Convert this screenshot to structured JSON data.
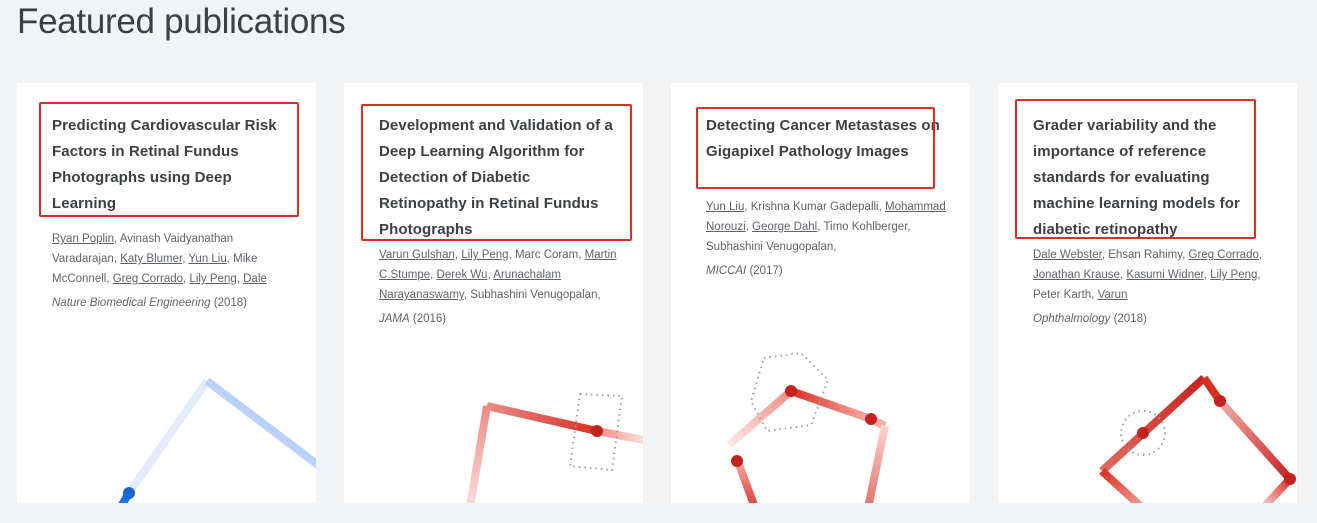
{
  "page": {
    "title": "Featured publications"
  },
  "cards": [
    {
      "title": "Predicting Cardiovascular Risk Factors in Retinal Fundus Photographs using Deep Learning",
      "authors": [
        {
          "name": "Ryan Poplin",
          "link": true
        },
        {
          "name": "Avinash Vaidyanathan Varadarajan",
          "link": false
        },
        {
          "name": "Katy Blumer",
          "link": true
        },
        {
          "name": "Yun Liu",
          "link": true
        },
        {
          "name": "Mike McConnell",
          "link": false
        },
        {
          "name": "Greg Corrado",
          "link": true
        },
        {
          "name": "Lily Peng",
          "link": true
        },
        {
          "name": "Dale",
          "link": true
        }
      ],
      "venue": "Nature Biomedical Engineering",
      "year": "(2018)"
    },
    {
      "title": "Development and Validation of a Deep Learning Algorithm for Detection of Diabetic Retinopathy in Retinal Fundus Photographs",
      "authors": [
        {
          "name": "Varun Gulshan",
          "link": true
        },
        {
          "name": "Lily Peng",
          "link": true
        },
        {
          "name": "Marc Coram",
          "link": false
        },
        {
          "name": "Martin C Stumpe",
          "link": true
        },
        {
          "name": "Derek Wu",
          "link": true
        },
        {
          "name": "Arunachalam Narayanaswamy",
          "link": true
        },
        {
          "name": "Subhashini Venugopalan",
          "link": false
        }
      ],
      "venue": "JAMA",
      "year": "(2016)"
    },
    {
      "title": "Detecting Cancer Metastases on Gigapixel Pathology Images",
      "authors": [
        {
          "name": "Yun Liu",
          "link": true
        },
        {
          "name": "Krishna Kumar Gadepalli",
          "link": false
        },
        {
          "name": "Mohammad Norouzi",
          "link": true
        },
        {
          "name": "George Dahl",
          "link": true
        },
        {
          "name": "Timo Kohlberger",
          "link": false
        },
        {
          "name": "Subhashini Venugopalan",
          "link": false
        }
      ],
      "venue": "MICCAI",
      "year": "(2017)"
    },
    {
      "title": "Grader variability and the importance of reference standards for evaluating machine learning models for diabetic retinopathy",
      "authors": [
        {
          "name": "Dale Webster",
          "link": true
        },
        {
          "name": "Ehsan Rahimy",
          "link": false
        },
        {
          "name": "Greg Corrado",
          "link": true
        },
        {
          "name": "Jonathan Krause",
          "link": true
        },
        {
          "name": "Kasumi Widner",
          "link": true
        },
        {
          "name": "Lily Peng",
          "link": true
        },
        {
          "name": "Peter Karth",
          "link": false
        },
        {
          "name": "Varun",
          "link": true
        }
      ],
      "venue": "Ophthalmology",
      "year": "(2018)"
    }
  ],
  "colors": {
    "highlight": "#d93025",
    "blue_accent": "#1a73e8",
    "red_accent": "#c5221f"
  }
}
